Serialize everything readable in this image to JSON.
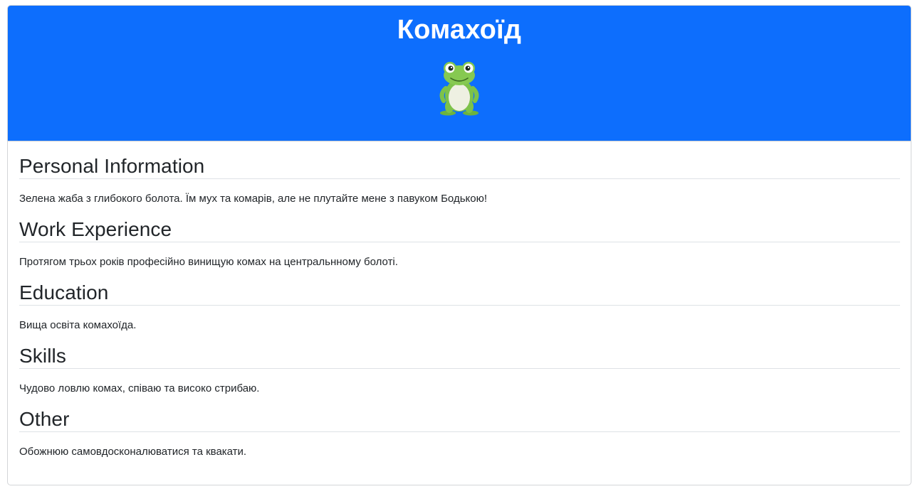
{
  "header": {
    "name": "Комахоїд",
    "avatar_icon": "frog-icon",
    "bg_color": "#0d6efd"
  },
  "sections": [
    {
      "heading": "Personal Information",
      "text": "Зелена жаба з глибокого болота. Їм мух та комарів, але не плутайте мене з павуком Бодькою!"
    },
    {
      "heading": "Work Experience",
      "text": "Протягом трьох років професійно винищую комах на центральнному болоті."
    },
    {
      "heading": "Education",
      "text": "Вища освіта комахоїда."
    },
    {
      "heading": "Skills",
      "text": "Чудово ловлю комах, співаю та високо стрибаю."
    },
    {
      "heading": "Other",
      "text": "Обожнюю самовдосконалюватися та квакати."
    }
  ]
}
